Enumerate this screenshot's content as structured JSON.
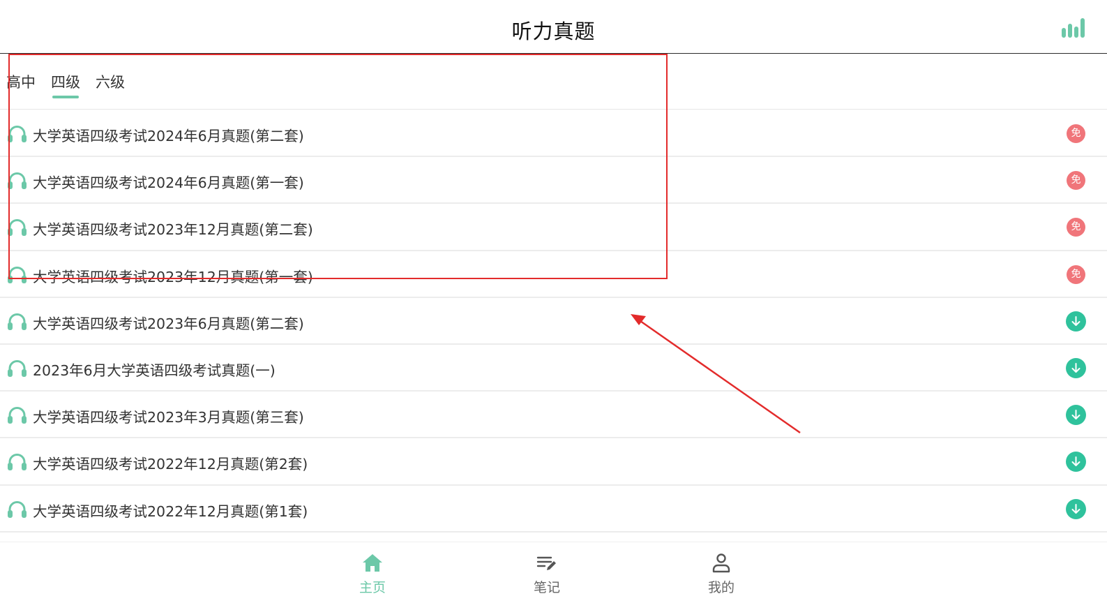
{
  "header": {
    "title": "听力真题",
    "stats_icon": "bar-chart-icon"
  },
  "tabs": [
    {
      "label": "高中",
      "active": false
    },
    {
      "label": "四级",
      "active": true
    },
    {
      "label": "六级",
      "active": false
    }
  ],
  "list": {
    "items": [
      {
        "title": "大学英语四级考试2024年6月真题(第二套)",
        "badge": "free",
        "badge_text": "免"
      },
      {
        "title": "大学英语四级考试2024年6月真题(第一套)",
        "badge": "free",
        "badge_text": "免"
      },
      {
        "title": "大学英语四级考试2023年12月真题(第二套)",
        "badge": "free",
        "badge_text": "免"
      },
      {
        "title": "大学英语四级考试2023年12月真题(第一套)",
        "badge": "free",
        "badge_text": "免"
      },
      {
        "title": "大学英语四级考试2023年6月真题(第二套)",
        "badge": "download"
      },
      {
        "title": "2023年6月大学英语四级考试真题(一)",
        "badge": "download"
      },
      {
        "title": "大学英语四级考试2023年3月真题(第三套)",
        "badge": "download"
      },
      {
        "title": "大学英语四级考试2022年12月真题(第2套)",
        "badge": "download"
      },
      {
        "title": "大学英语四级考试2022年12月真题(第1套)",
        "badge": "download"
      }
    ]
  },
  "navbar": {
    "items": [
      {
        "label": "主页",
        "icon": "home-icon",
        "active": true
      },
      {
        "label": "笔记",
        "icon": "notes-edit-icon",
        "active": false
      },
      {
        "label": "我的",
        "icon": "user-icon",
        "active": false
      }
    ]
  },
  "colors": {
    "accent": "#6cc8a8",
    "free_badge": "#f0757a",
    "download_badge": "#2fc29c",
    "annotation": "#e32b2b"
  }
}
